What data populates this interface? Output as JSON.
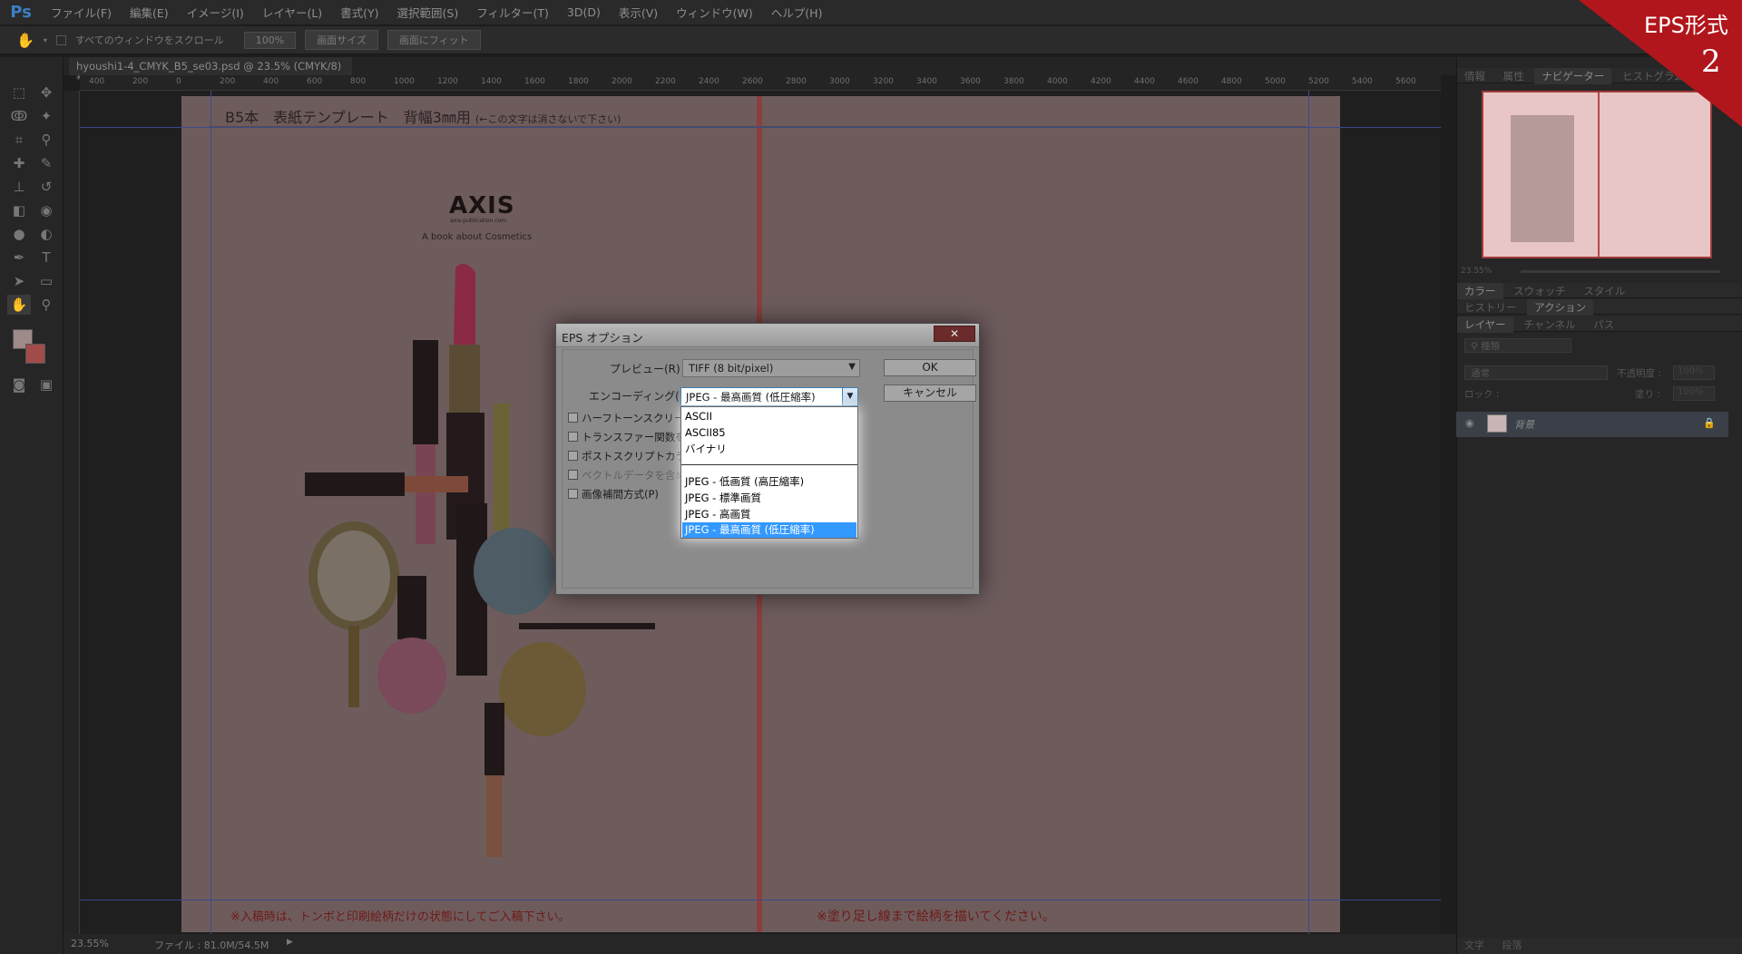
{
  "app": {
    "logo": "Ps",
    "menu": [
      "ファイル(F)",
      "編集(E)",
      "イメージ(I)",
      "レイヤー(L)",
      "書式(Y)",
      "選択範囲(S)",
      "フィルター(T)",
      "3D(D)",
      "表示(V)",
      "ウィンドウ(W)",
      "ヘルプ(H)"
    ]
  },
  "options_bar": {
    "scroll_all_label": "すべてのウィンドウをスクロール",
    "zoom_100": "100%",
    "fit_screen": "画面サイズ",
    "fill_screen": "画面にフィット"
  },
  "document": {
    "tab_title": "hyoushi1-4_CMYK_B5_se03.psd @ 23.5% (CMYK/8) *",
    "tab_close": "×",
    "ruler_ticks": [
      "400",
      "200",
      "0",
      "200",
      "400",
      "600",
      "800",
      "1000",
      "1200",
      "1400",
      "1600",
      "1800",
      "2000",
      "2200",
      "2400",
      "2600",
      "2800",
      "3000",
      "3200",
      "3400",
      "3600",
      "3800",
      "4000",
      "4200",
      "4400",
      "4600",
      "4800",
      "5000",
      "5200",
      "5400",
      "5600"
    ],
    "template_title": "B5本　表紙テンプレート　背幅3㎜用",
    "template_title_note": "(←この文字は消さないで下さい)",
    "brand_logo": "AXIS",
    "brand_url": "axis-publication.com",
    "brand_tagline": "A  book about  Cosmetics",
    "note_left": "※入稿時は、トンボと印刷絵柄だけの状態にしてご入稿下さい。",
    "note_right": "※塗り足し線まで絵柄を描いてください。"
  },
  "dialog": {
    "title": "EPS オプション",
    "close_label": "✕",
    "preview_label": "プレビュー(R) :",
    "preview_value": "TIFF (8 bit/pixel)",
    "encoding_label": "エンコーディング(E) :",
    "encoding_value": "JPEG - 最高画質 (低圧縮率)",
    "ok_label": "OK",
    "cancel_label": "キャンセル",
    "checkboxes": [
      "ハーフトーンスクリーンを",
      "トランスファー関数を含む",
      "ポストスクリプトカラーマ",
      "ベクトルデータを含める",
      "画像補間方式(P)"
    ],
    "encoding_options_group1": [
      "ASCII",
      "ASCII85",
      "バイナリ"
    ],
    "encoding_options_group2": [
      "JPEG - 低画質 (高圧縮率)",
      "JPEG - 標準画質",
      "JPEG - 高画質"
    ],
    "encoding_selected": "JPEG - 最高画質 (低圧縮率)"
  },
  "panels": {
    "top_tabs": [
      "情報",
      "属性",
      "ナビゲーター",
      "ヒストグラム"
    ],
    "nav_zoom": "23.55%",
    "color_tabs": [
      "カラー",
      "スウォッチ",
      "スタイル"
    ],
    "history_tabs": [
      "ヒストリー",
      "アクション"
    ],
    "layer_tabs": [
      "レイヤー",
      "チャンネル",
      "パス"
    ],
    "kind_filter": "種類",
    "blend_mode": "通常",
    "opacity_label": "不透明度 :",
    "opacity_value": "100%",
    "lock_label": "ロック :",
    "fill_label": "塗り :",
    "fill_value": "100%",
    "layer_name": "背景",
    "bottom_tabs": [
      "文字",
      "段落"
    ]
  },
  "status": {
    "zoom": "23.55%",
    "file_info": "ファイル : 81.0M/54.5M"
  },
  "corner_badge": {
    "title": "EPS形式",
    "number": "2",
    "color": "#b0161b"
  },
  "colors": {
    "accent_blue": "#3399ff",
    "spine_red": "#8a3f3f"
  }
}
